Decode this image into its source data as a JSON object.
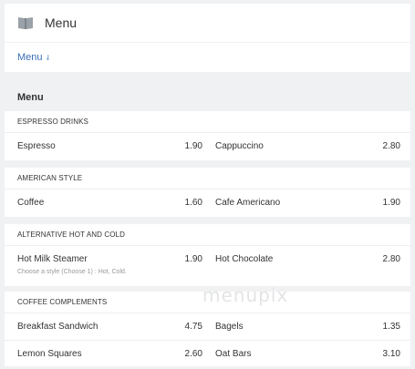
{
  "header": {
    "title": "Menu",
    "icon": "book-icon"
  },
  "breadcrumb": {
    "label": "Menu",
    "arrow": "⇃"
  },
  "menu_heading": "Menu",
  "sections": [
    {
      "title": "ESPRESSO DRINKS",
      "rows": [
        {
          "left_name": "Espresso",
          "left_price": "1.90",
          "right_name": "Cappuccino",
          "right_price": "2.80"
        }
      ]
    },
    {
      "title": "AMERICAN STYLE",
      "rows": [
        {
          "left_name": "Coffee",
          "left_price": "1.60",
          "right_name": "Cafe Americano",
          "right_price": "1.90"
        }
      ]
    },
    {
      "title": "ALTERNATIVE HOT AND COLD",
      "rows": [
        {
          "left_name": "Hot Milk Steamer",
          "left_price": "1.90",
          "left_sub": "Choose a style (Choose 1) : Hot, Cold.",
          "right_name": "Hot Chocolate",
          "right_price": "2.80"
        }
      ]
    },
    {
      "title": "COFFEE COMPLEMENTS",
      "rows": [
        {
          "left_name": "Breakfast Sandwich",
          "left_price": "4.75",
          "right_name": "Bagels",
          "right_price": "1.35"
        },
        {
          "left_name": "Lemon Squares",
          "left_price": "2.60",
          "right_name": "Oat Bars",
          "right_price": "3.10"
        }
      ]
    }
  ],
  "watermark": "menupix"
}
